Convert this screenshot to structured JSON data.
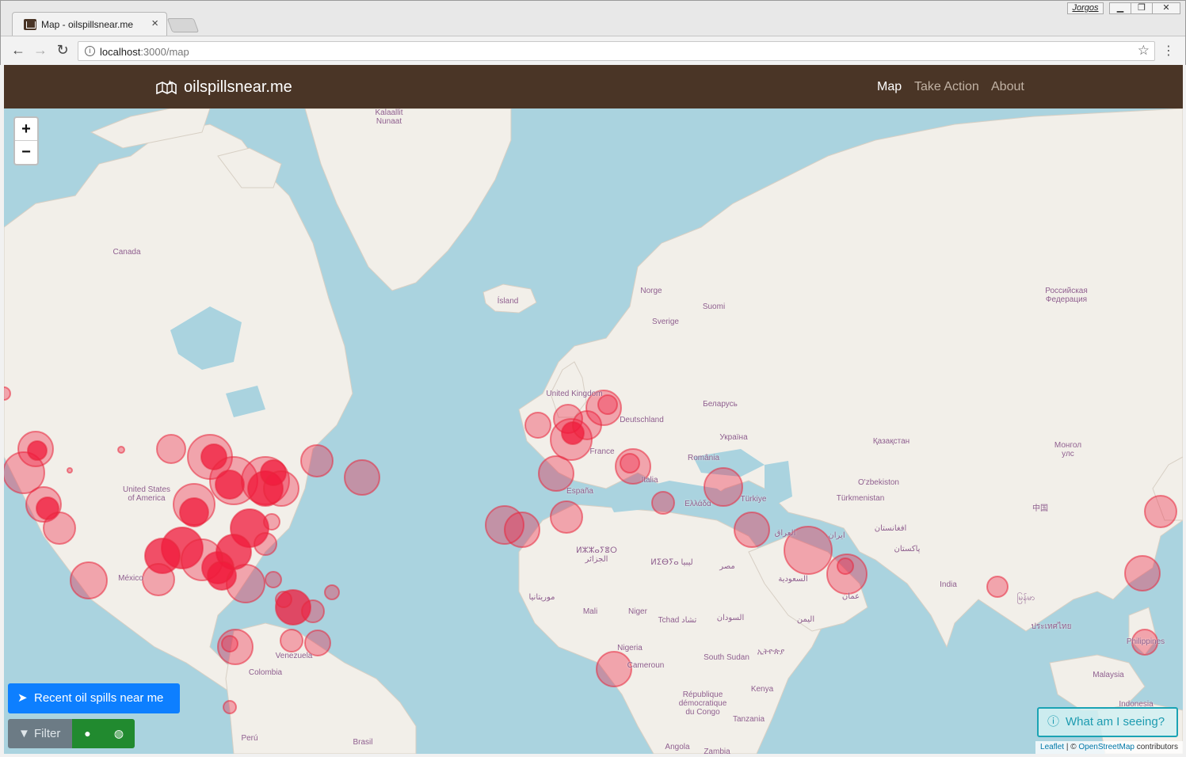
{
  "browser": {
    "tab_title": "Map - oilspillsnear.me",
    "url_host": "localhost",
    "url_path": ":3000/map",
    "user_label": "Jorgos",
    "icons": [
      "back-icon",
      "forward-icon",
      "reload-icon",
      "info-icon",
      "star-icon",
      "menu-icon"
    ]
  },
  "navbar": {
    "brand": "oilspillsnear.me",
    "brand_color": "#4a3526",
    "links": [
      {
        "label": "Map",
        "active": true
      },
      {
        "label": "Take Action",
        "active": false
      },
      {
        "label": "About",
        "active": false
      }
    ]
  },
  "map": {
    "zoom_in": "+",
    "zoom_out": "−",
    "spill_color": "#f0193b",
    "labels": [
      {
        "text": "Kalaallit\nNunaat"
      },
      {
        "text": "Canada"
      },
      {
        "text": "Ísland"
      },
      {
        "text": "Norge"
      },
      {
        "text": "Suomi"
      },
      {
        "text": "Sverige"
      },
      {
        "text": "Российская\nФедерация"
      },
      {
        "text": "United Kingdom"
      },
      {
        "text": "Deutschland"
      },
      {
        "text": "Беларусь"
      },
      {
        "text": "Україна"
      },
      {
        "text": "France"
      },
      {
        "text": "România"
      },
      {
        "text": "Қазақстан"
      },
      {
        "text": "Монгол\nулс"
      },
      {
        "text": "Italia"
      },
      {
        "text": "O'zbekiston"
      },
      {
        "text": "United States\nof America"
      },
      {
        "text": "España"
      },
      {
        "text": "Türkiye"
      },
      {
        "text": "Ελλάδα"
      },
      {
        "text": "Türkmenistan"
      },
      {
        "text": "中国"
      },
      {
        "text": "العراق"
      },
      {
        "text": "ایران"
      },
      {
        "text": "افغانستان"
      },
      {
        "text": "ⵍⵣⵣⴰⵢⴻⵔ\nالجزائر"
      },
      {
        "text": "ⵍⵉⴱⵢⴰ ليبيا"
      },
      {
        "text": "مصر"
      },
      {
        "text": "پاکستان"
      },
      {
        "text": "México"
      },
      {
        "text": "السعودية"
      },
      {
        "text": "India"
      },
      {
        "text": "عمان"
      },
      {
        "text": "موريتانيا"
      },
      {
        "text": "Mali"
      },
      {
        "text": "Niger"
      },
      {
        "text": "Tchad تشاد"
      },
      {
        "text": "السودان"
      },
      {
        "text": "မြန်မာ"
      },
      {
        "text": "اليمن"
      },
      {
        "text": "ประเทศไทย"
      },
      {
        "text": "Philippines"
      },
      {
        "text": "Venezuela"
      },
      {
        "text": "Nigeria"
      },
      {
        "text": "South Sudan"
      },
      {
        "text": "ኢትዮጵያ"
      },
      {
        "text": "Colombia"
      },
      {
        "text": "Cameroun"
      },
      {
        "text": "Malaysia"
      },
      {
        "text": "Kenya"
      },
      {
        "text": "République\ndémocratique\ndu Congo"
      },
      {
        "text": "Indonesia"
      },
      {
        "text": "Tanzania"
      },
      {
        "text": "Perú"
      },
      {
        "text": "Brasil"
      },
      {
        "text": "Angola"
      },
      {
        "text": "Zambia"
      }
    ]
  },
  "controls": {
    "recent_label": "Recent oil spills near me",
    "filter_label": "Filter",
    "what_label": "What am I seeing?",
    "attribution_leaflet": "Leaflet",
    "attribution_sep": " | © ",
    "attribution_osm": "OpenStreetMap",
    "attribution_tail": " contributors"
  }
}
